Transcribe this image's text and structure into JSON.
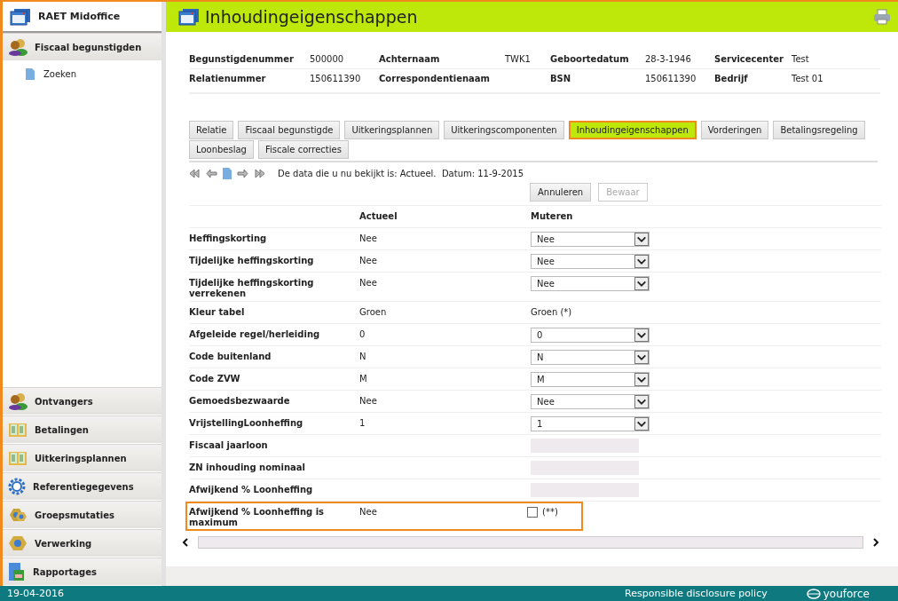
{
  "sidebar": {
    "title": "RAET Midoffice",
    "sections": [
      {
        "label": "Fiscaal begunstigden",
        "kind": "people",
        "children": [
          {
            "label": "Zoeken"
          }
        ]
      },
      {
        "label": "Ontvangers",
        "kind": "people"
      },
      {
        "label": "Betalingen",
        "kind": "book"
      },
      {
        "label": "Uitkeringsplannen",
        "kind": "book"
      },
      {
        "label": "Referentiegegevens",
        "kind": "gear"
      },
      {
        "label": "Groepsmutaties",
        "kind": "nuts"
      },
      {
        "label": "Verwerking",
        "kind": "nut"
      },
      {
        "label": "Rapportages",
        "kind": "report"
      }
    ]
  },
  "page": {
    "title": "Inhoudingeigenschappen"
  },
  "info": [
    [
      {
        "label": "Begunstigdenummer",
        "value": "500000"
      },
      {
        "label": "Achternaam",
        "value": "TWK1"
      },
      {
        "label": "Geboortedatum",
        "value": "28-3-1946"
      },
      {
        "label": "Servicecenter",
        "value": "Test"
      }
    ],
    [
      {
        "label": "Relatienummer",
        "value": "150611390"
      },
      {
        "label": "Correspondentienaam"
      },
      {
        "label": "BSN",
        "value": "150611390"
      },
      {
        "label": "Bedrijf",
        "value": "Test 01"
      }
    ]
  ],
  "tabs": [
    {
      "label": "Relatie",
      "selected": false
    },
    {
      "label": "Fiscaal begunstigde",
      "selected": false
    },
    {
      "label": "Uitkeringsplannen",
      "selected": false
    },
    {
      "label": "Uitkeringscomponenten",
      "selected": false
    },
    {
      "label": "Inhoudingeigenschappen",
      "selected": true
    },
    {
      "label": "Vorderingen",
      "selected": false
    },
    {
      "label": "Betalingsregeling",
      "selected": false
    },
    {
      "label": "Loonbeslag",
      "selected": false
    },
    {
      "label": "Fiscale correcties",
      "selected": false
    }
  ],
  "status_text": "De data die u nu bekijkt is: Actueel.  Datum: 11-9-2015",
  "buttons": [
    {
      "label": "Annuleren",
      "disabled": false
    },
    {
      "label": "Bewaar",
      "disabled": true
    }
  ],
  "table": {
    "columns": [
      "Actueel",
      "Muteren"
    ],
    "rows": [
      {
        "label": "Heffingskorting",
        "current": "Nee",
        "kind": "select",
        "value": "Nee"
      },
      {
        "label": "Tijdelijke heffingskorting",
        "current": "Nee",
        "kind": "select",
        "value": "Nee"
      },
      {
        "label": "Tijdelijke heffingskorting verrekenen",
        "current": "Nee",
        "kind": "select",
        "value": "Nee"
      },
      {
        "label": "Kleur tabel",
        "current": "Groen",
        "kind": "text",
        "value": "Groen (*)"
      },
      {
        "label": "Afgeleide regel/herleiding",
        "current": "0",
        "kind": "select",
        "value": "0"
      },
      {
        "label": "Code buitenland",
        "current": "N",
        "kind": "select",
        "value": "N"
      },
      {
        "label": "Code ZVW",
        "current": "M",
        "kind": "select",
        "value": "M"
      },
      {
        "label": "Gemoedsbezwaarde",
        "current": "Nee",
        "kind": "select",
        "value": "Nee"
      },
      {
        "label": "VrijstellingLoonheffing",
        "current": "1",
        "kind": "select",
        "value": "1"
      },
      {
        "label": "Fiscaal jaarloon",
        "kind": "input"
      },
      {
        "label": "ZN inhouding nominaal",
        "kind": "input"
      },
      {
        "label": "Afwijkend % Loonheffing",
        "kind": "input"
      },
      {
        "label": "Afwijkend % Loonheffing is maximum",
        "current": "Nee",
        "kind": "checkbox",
        "checked": false,
        "note": "(**)",
        "highlighted": true
      }
    ]
  },
  "footer": {
    "date": "19-04-2016",
    "link": "Responsible disclosure policy",
    "logo": "youforce"
  }
}
